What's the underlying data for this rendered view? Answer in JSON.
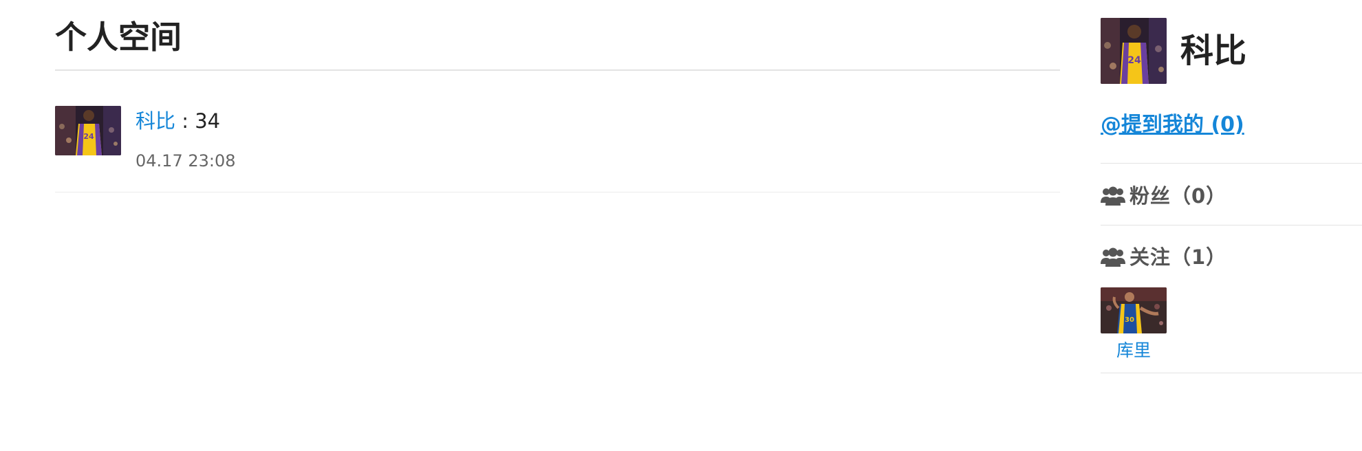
{
  "page": {
    "title": "个人空间"
  },
  "post": {
    "author": "科比",
    "separator": ":",
    "content": "34",
    "time": "04.17 23:08"
  },
  "sidebar": {
    "username": "科比",
    "mentions_label": "@提到我的 (0)",
    "followers": {
      "icon": "users-icon",
      "label": "粉丝（0）"
    },
    "following": {
      "icon": "users-icon",
      "label": "关注（1）",
      "users": [
        {
          "name": "库里"
        }
      ]
    }
  },
  "colors": {
    "link": "#1586d8",
    "text": "#222222",
    "muted": "#666666",
    "divider": "#e3e3e3"
  }
}
